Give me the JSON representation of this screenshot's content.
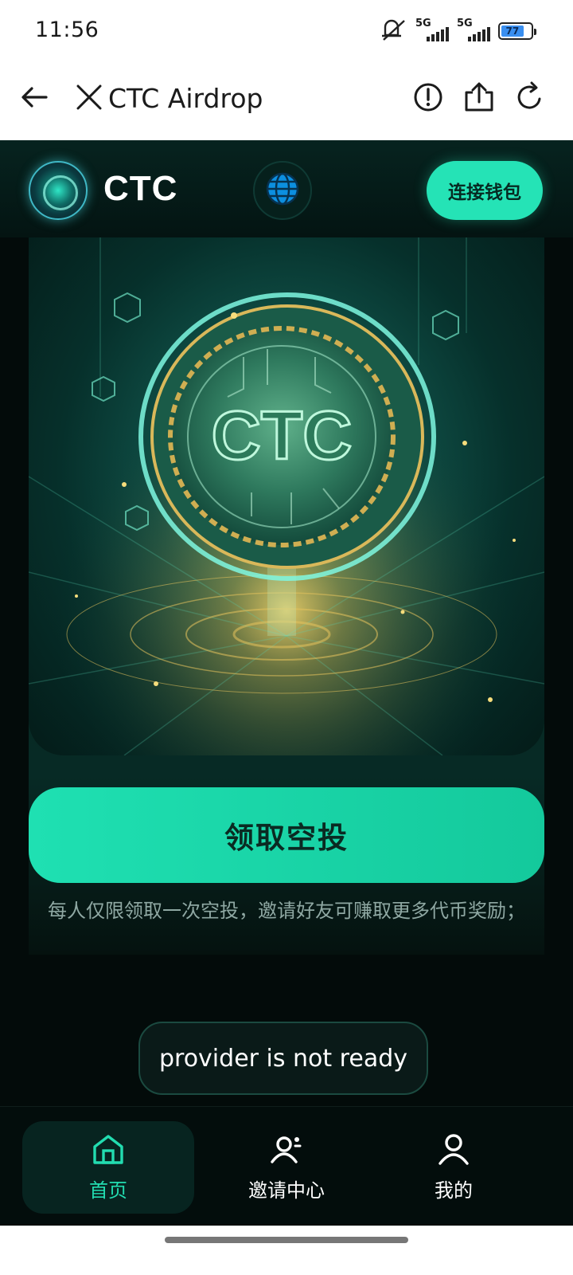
{
  "status_bar": {
    "time": "11:56",
    "network_1": "5G",
    "network_2": "5G",
    "battery_percent": "77",
    "battery_level": 0.77
  },
  "nav": {
    "title": "CTC Airdrop",
    "icons": [
      "back-arrow-icon",
      "close-icon",
      "info-icon",
      "share-icon",
      "refresh-icon"
    ]
  },
  "header": {
    "brand": "CTC",
    "connect_wallet": "连接钱包",
    "icons": [
      "ctc-logo",
      "globe-icon"
    ]
  },
  "hero": {
    "coin_text": "CTC"
  },
  "main": {
    "claim_button": "领取空投",
    "note": "每人仅限领取一次空投，邀请好友可赚取更多代币奖励；"
  },
  "toast": {
    "message": "provider is not ready"
  },
  "tabbar": {
    "tabs": [
      {
        "label": "首页",
        "icon": "home-icon",
        "active": true
      },
      {
        "label": "邀请中心",
        "icon": "invite-icon",
        "active": false
      },
      {
        "label": "我的",
        "icon": "profile-icon",
        "active": false
      }
    ]
  },
  "colors": {
    "accent": "#25e3b6",
    "background": "#030b0a",
    "active_tab": "#22dcb0"
  }
}
